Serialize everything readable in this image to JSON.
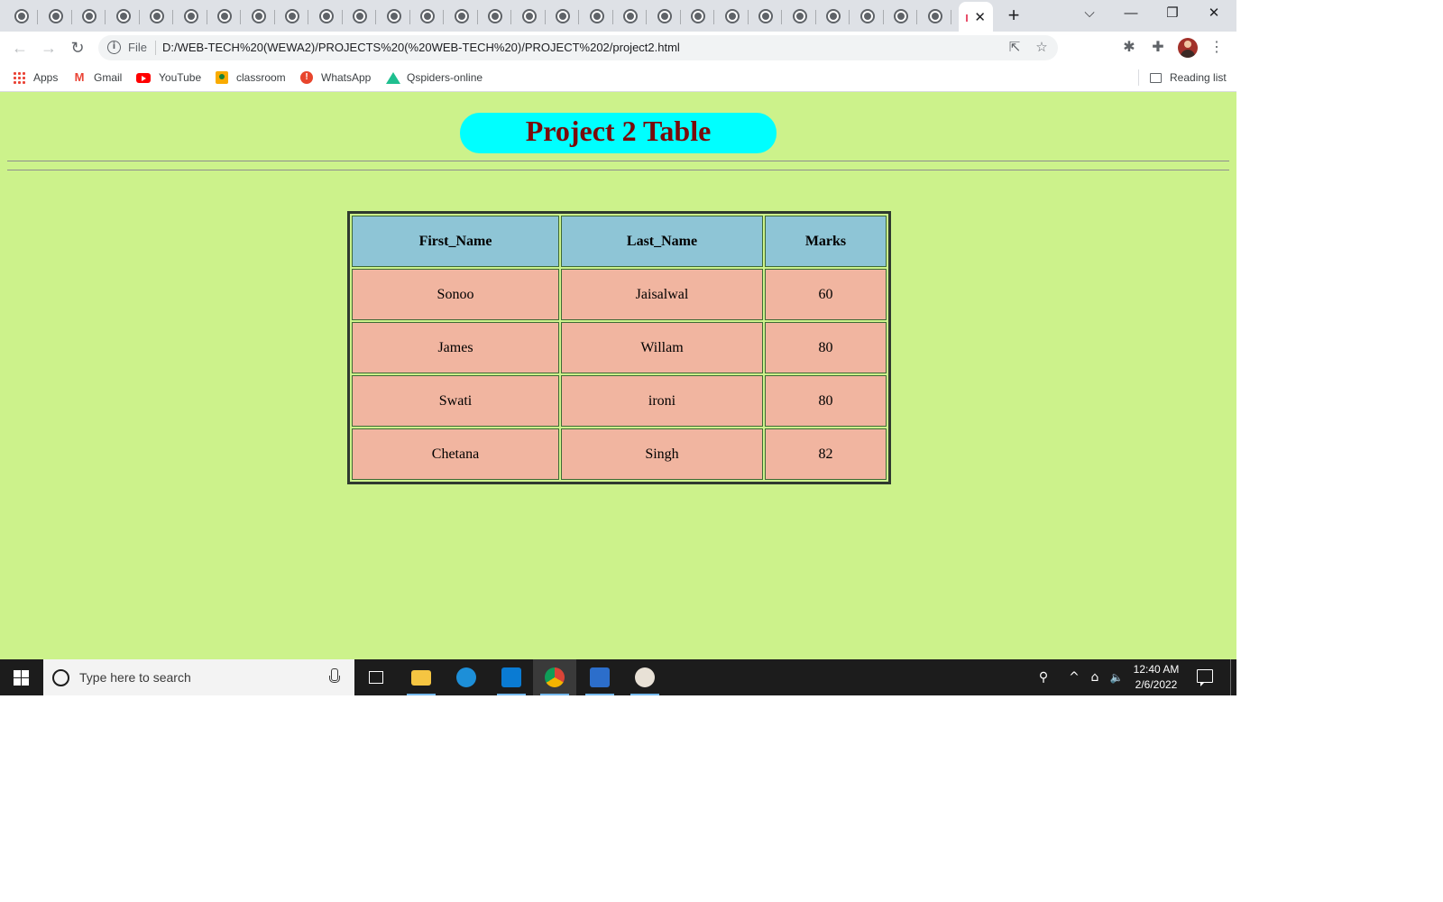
{
  "browser": {
    "inactive_tab_count": 28,
    "new_tab_symbol": "+",
    "active_tab_close": "✕",
    "window_controls": {
      "tab_search": "⌵",
      "minimize": "—",
      "restore": "❐",
      "close": "✕"
    },
    "nav": {
      "back": "←",
      "forward": "→",
      "reload": "↻"
    },
    "address": {
      "info_icon": "i",
      "scheme_label": "File",
      "url": "D:/WEB-TECH%20(WEWA2)/PROJECTS%20(%20WEB-TECH%20)/PROJECT%202/project2.html"
    },
    "toolbar_icons": [
      "share-icon",
      "star-icon",
      "extension-bug-icon",
      "puzzle-icon",
      "avatar",
      "menu-icon"
    ],
    "bookmarks": [
      {
        "label": "Apps",
        "icon": "apps-grid-icon"
      },
      {
        "label": "Gmail",
        "icon": "gmail-icon"
      },
      {
        "label": "YouTube",
        "icon": "youtube-icon"
      },
      {
        "label": "classroom",
        "icon": "classroom-icon"
      },
      {
        "label": "WhatsApp",
        "icon": "whatsapp-icon"
      },
      {
        "label": "Qspiders-online",
        "icon": "qspiders-icon"
      }
    ],
    "reading_list": "Reading list"
  },
  "page": {
    "title": "Project 2 Table",
    "background": "#ccf28b",
    "title_bg": "#00ffff",
    "title_color": "#7a0a0a",
    "table": {
      "headers": [
        "First_Name",
        "Last_Name",
        "Marks"
      ],
      "rows": [
        [
          "Sonoo",
          "Jaisalwal",
          "60"
        ],
        [
          "James",
          "Willam",
          "80"
        ],
        [
          "Swati",
          "ironi",
          "80"
        ],
        [
          "Chetana",
          "Singh",
          "82"
        ]
      ],
      "header_bg": "#8ec5d6",
      "cell_bg": "#f1b5a0"
    }
  },
  "taskbar": {
    "search_placeholder": "Type here to search",
    "apps": [
      "task-view-icon",
      "file-explorer-icon",
      "edge-icon",
      "vscode-icon",
      "chrome-icon",
      "photos-icon",
      "paint-icon"
    ],
    "tray": {
      "people": "⚲",
      "chevron": "^",
      "network": "⌂",
      "volume": "🔈"
    },
    "time": "12:40 AM",
    "date": "2/6/2022"
  }
}
